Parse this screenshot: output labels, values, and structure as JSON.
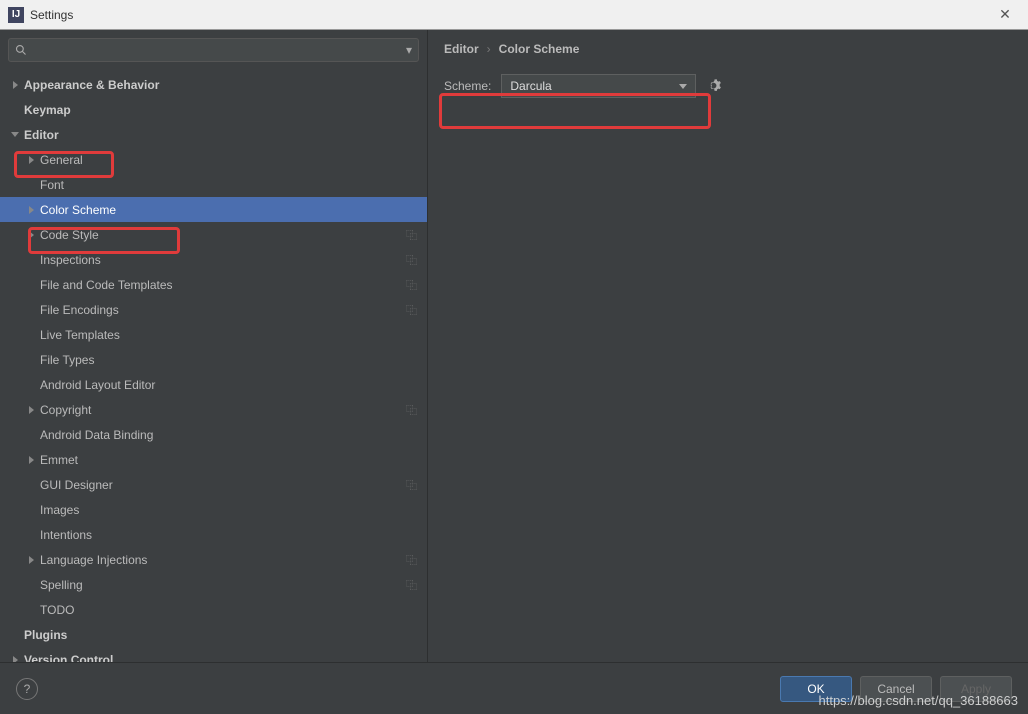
{
  "window": {
    "title": "Settings"
  },
  "search": {
    "placeholder": ""
  },
  "tree": [
    {
      "label": "Appearance & Behavior",
      "level": 0,
      "arrow": "right",
      "bold": true
    },
    {
      "label": "Keymap",
      "level": 0,
      "arrow": "",
      "bold": true
    },
    {
      "label": "Editor",
      "level": 0,
      "arrow": "down",
      "bold": true
    },
    {
      "label": "General",
      "level": 1,
      "arrow": "right"
    },
    {
      "label": "Font",
      "level": 1,
      "arrow": ""
    },
    {
      "label": "Color Scheme",
      "level": 1,
      "arrow": "right",
      "selected": true
    },
    {
      "label": "Code Style",
      "level": 1,
      "arrow": "right",
      "badge": "⿻"
    },
    {
      "label": "Inspections",
      "level": 1,
      "arrow": "",
      "badge": "⿻"
    },
    {
      "label": "File and Code Templates",
      "level": 1,
      "arrow": "",
      "badge": "⿻"
    },
    {
      "label": "File Encodings",
      "level": 1,
      "arrow": "",
      "badge": "⿻"
    },
    {
      "label": "Live Templates",
      "level": 1,
      "arrow": ""
    },
    {
      "label": "File Types",
      "level": 1,
      "arrow": ""
    },
    {
      "label": "Android Layout Editor",
      "level": 1,
      "arrow": ""
    },
    {
      "label": "Copyright",
      "level": 1,
      "arrow": "right",
      "badge": "⿻"
    },
    {
      "label": "Android Data Binding",
      "level": 1,
      "arrow": ""
    },
    {
      "label": "Emmet",
      "level": 1,
      "arrow": "right"
    },
    {
      "label": "GUI Designer",
      "level": 1,
      "arrow": "",
      "badge": "⿻"
    },
    {
      "label": "Images",
      "level": 1,
      "arrow": ""
    },
    {
      "label": "Intentions",
      "level": 1,
      "arrow": ""
    },
    {
      "label": "Language Injections",
      "level": 1,
      "arrow": "right",
      "badge": "⿻"
    },
    {
      "label": "Spelling",
      "level": 1,
      "arrow": "",
      "badge": "⿻"
    },
    {
      "label": "TODO",
      "level": 1,
      "arrow": ""
    },
    {
      "label": "Plugins",
      "level": 0,
      "arrow": "",
      "bold": true
    },
    {
      "label": "Version Control",
      "level": 0,
      "arrow": "right",
      "bold": true
    }
  ],
  "breadcrumb": {
    "part1": "Editor",
    "sep": "›",
    "part2": "Color Scheme"
  },
  "scheme": {
    "label": "Scheme:",
    "value": "Darcula"
  },
  "buttons": {
    "ok": "OK",
    "cancel": "Cancel",
    "apply": "Apply",
    "help": "?"
  },
  "watermark": "https://blog.csdn.net/qq_36188663"
}
